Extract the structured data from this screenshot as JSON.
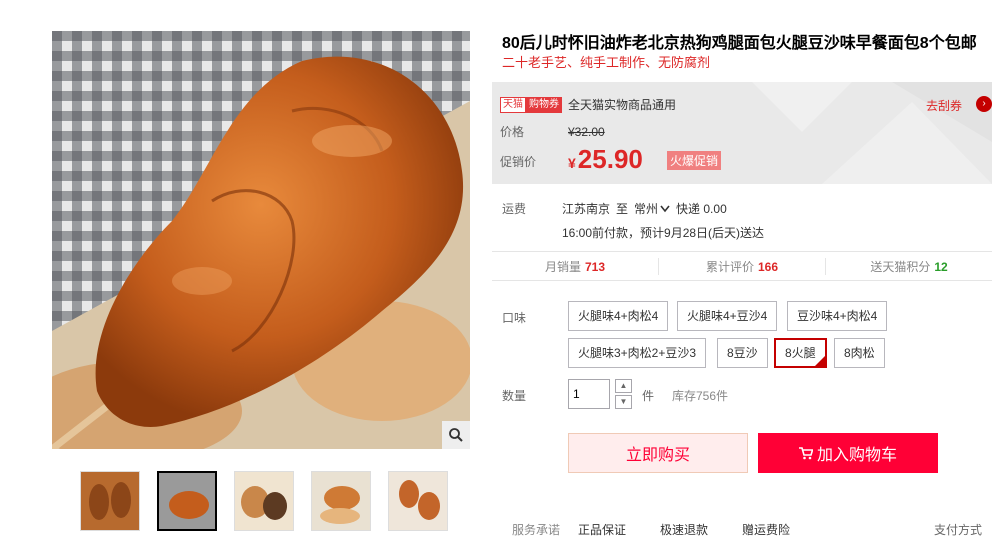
{
  "product": {
    "title": "80后儿时怀旧油炸老北京热狗鸡腿面包火腿豆沙味早餐面包8个包邮",
    "subtitle": "二十老手艺、纯手工制作、无防腐剂"
  },
  "coupon": {
    "tmall_tag": "天猫",
    "coupon_tag": "购物券",
    "text": "全天猫实物商品通用",
    "link": "去刮券",
    "arrow": "›"
  },
  "price": {
    "label": "价格",
    "original": "¥32.00",
    "promo_label": "促销价",
    "currency": "¥",
    "promo": "25.90",
    "badge": "火爆促销"
  },
  "shipping": {
    "label": "运费",
    "from": "江苏南京",
    "to_word": "至",
    "to": "常州",
    "express": "快递 0.00",
    "note": "16:00前付款，预计9月28日(后天)送达"
  },
  "stats": [
    {
      "label": "月销量",
      "value": "713"
    },
    {
      "label": "累计评价",
      "value": "166"
    },
    {
      "label": "送天猫积分",
      "value": "12"
    }
  ],
  "flavor": {
    "label": "口味",
    "options": [
      "火腿味4+肉松4",
      "火腿味4+豆沙4",
      "豆沙味4+肉松4",
      "火腿味3+肉松2+豆沙3",
      "8豆沙",
      "8火腿",
      "8肉松"
    ],
    "selected": "8火腿"
  },
  "quantity": {
    "label": "数量",
    "value": "1",
    "unit": "件",
    "stock": "库存756件"
  },
  "actions": {
    "buy_now": "立即购买",
    "add_cart": "加入购物车"
  },
  "services": {
    "label": "服务承诺",
    "items": [
      "正品保证",
      "极速退款",
      "赠运费险"
    ],
    "pay": "支付方式"
  },
  "icons": {
    "zoom": "magnifier-icon",
    "cart": "cart-icon",
    "dropdown": "chevron-down-icon"
  },
  "colors": {
    "accent": "#ff0036",
    "price_red": "#dd2727",
    "brand_red": "#c40000"
  }
}
